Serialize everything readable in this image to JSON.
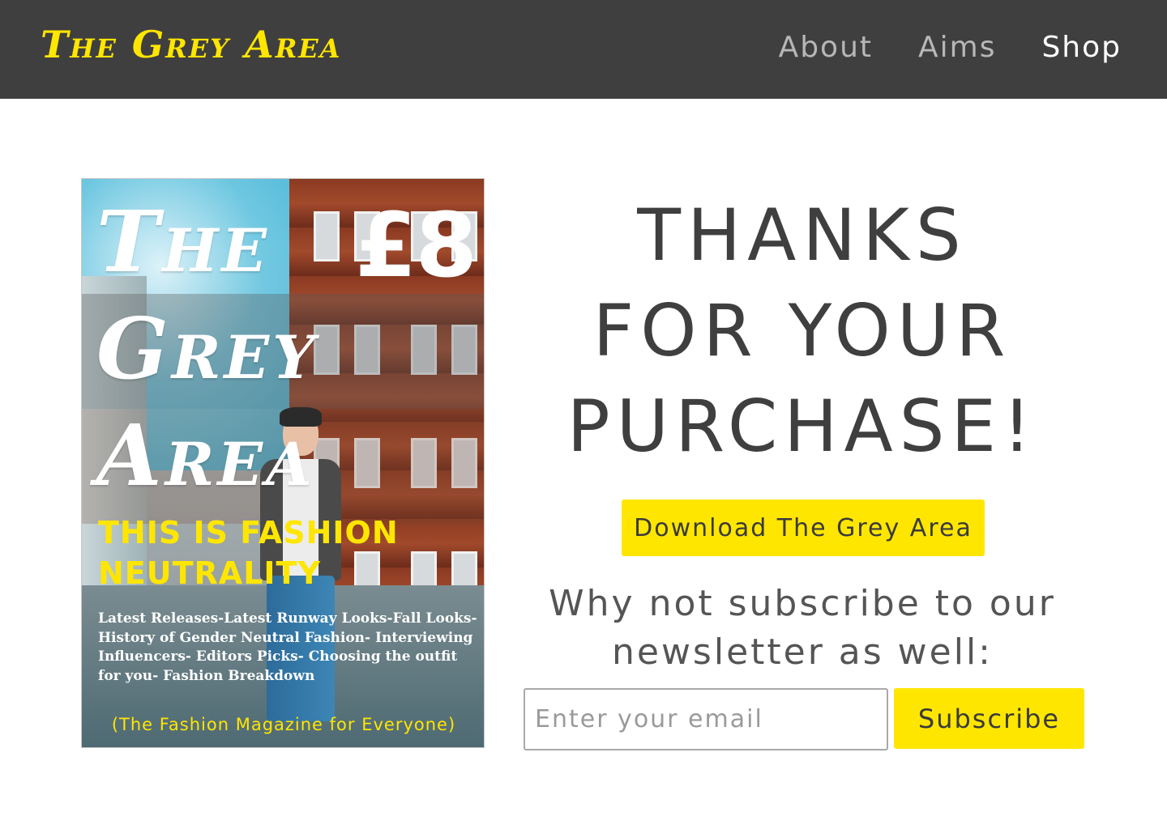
{
  "nav": {
    "brand": "The Grey Area",
    "links": [
      {
        "label": "About",
        "active": false
      },
      {
        "label": "Aims",
        "active": false
      },
      {
        "label": "Shop",
        "active": true
      }
    ]
  },
  "cover": {
    "title_lines": [
      "The",
      "Grey",
      "Area"
    ],
    "price": "£8",
    "tagline": "THIS IS FASHION NEUTRALITY",
    "blurb": "Latest Releases-Latest Runway Looks-Fall Looks- History of Gender Neutral Fashion- Interviewing Influencers- Editors Picks- Choosing the outfit for you- Fashion Breakdown",
    "footer": "(The Fashion Magazine for Everyone)"
  },
  "main": {
    "thanks_lines": [
      "THANKS",
      "FOR YOUR",
      "PURCHASE!"
    ],
    "download_label": "Download The Grey Area",
    "newsletter_text": "Why not subscribe to our newsletter as well:",
    "email_placeholder": "Enter your email",
    "subscribe_label": "Subscribe"
  },
  "colors": {
    "navbar": "#3f3f3f",
    "accent": "#ffe600",
    "text_dark": "#3f3f3f"
  }
}
